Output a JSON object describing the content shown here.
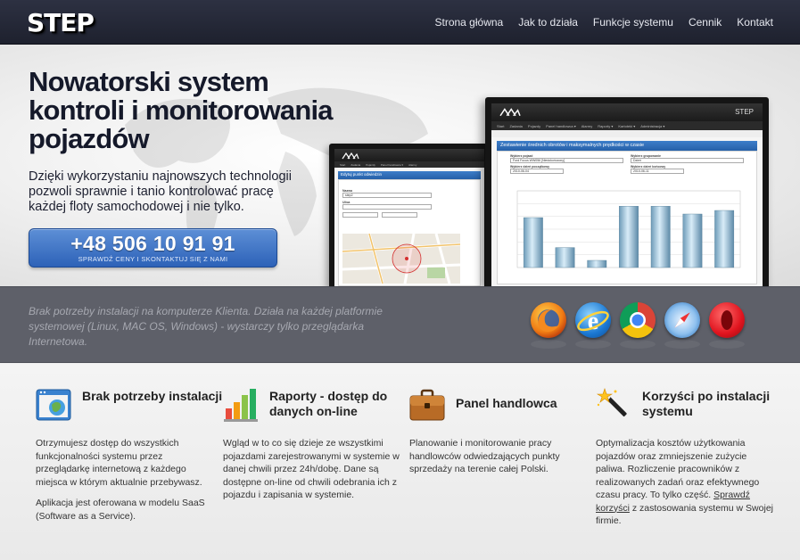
{
  "header": {
    "logo": "STEP",
    "nav": [
      "Strona główna",
      "Jak to działa",
      "Funkcje systemu",
      "Cennik",
      "Kontakt"
    ]
  },
  "hero": {
    "title_lines": [
      "Nowatorski system",
      "kontroli i monitorowania",
      "pojazdów"
    ],
    "subtitle": "Dzięki wykorzystaniu najnowszych technologii pozwoli sprawnie i tanio kontrolować pracę każdej floty samochodowej i nie tylko.",
    "phone": "+48 506 10 91 91",
    "phone_caption": "SPRAWDŹ CENY I SKONTAKTUJ SIĘ Z NAMI"
  },
  "screens": {
    "large": {
      "brand": "STEP",
      "menu": [
        "Start",
        "Zadania",
        "Pojazdy",
        "Panel handlowca ▾",
        "Alarmy",
        "Raporty ▾",
        "Kartoteki ▾",
        "Administracja ▾"
      ],
      "panel_title": "Zestawienie średnich obrotów i maksymalnych prędkości w czasie",
      "fields": [
        {
          "label": "Wybierz pojazd",
          "value": "Ford Focus WW056 [Niedokończony]"
        },
        {
          "label": "Wybierz grupowanie",
          "value": "Dzień"
        },
        {
          "label": "Wybierz dzień początkowy",
          "value": "2010-06-04"
        },
        {
          "label": "Wybierz dzień końcowy",
          "value": "2010-06-11"
        }
      ],
      "chart_bars": [
        0.7,
        0.28,
        0.1,
        0.86,
        0.86,
        0.75,
        0.8
      ]
    },
    "small": {
      "panel_title": "Edytuj punkt odwiedzin",
      "fields": [
        {
          "label": "Nazwa",
          "value": "step2"
        },
        {
          "label": "Ulica",
          "value": ""
        }
      ]
    }
  },
  "band": {
    "text": "Brak potrzeby instalacji na komputerze Klienta. Działa na każdej platformie systemowej (Linux, MAC OS, Windows) - wystarczy tylko przeglądarka Internetowa.",
    "browsers": [
      "firefox-icon",
      "internet-explorer-icon",
      "chrome-icon",
      "safari-icon",
      "opera-icon"
    ]
  },
  "features": [
    {
      "title": "Brak potrzeby instalacji",
      "paragraphs": [
        "Otrzymujesz dostęp do wszystkich funkcjonalności systemu przez przeglądarkę internetową z każdego miejsca w którym aktualnie przebywasz.",
        "Aplikacja jest oferowana w modelu SaaS (Software as a Service)."
      ]
    },
    {
      "title": "Raporty - dostęp do danych on-line",
      "paragraphs": [
        "Wgląd w to co się dzieje ze wszystkimi pojazdami zarejestrowanymi w systemie w danej chwili przez 24h/dobę. Dane są dostępne on-line od chwili odebrania ich z pojazdu i zapisania w systemie."
      ]
    },
    {
      "title": "Panel handlowca",
      "paragraphs": [
        "Planowanie i monitorowanie pracy handlowców odwiedzających punkty sprzedaży na terenie całej Polski."
      ]
    },
    {
      "title": "Korzyści po instalacji systemu",
      "text_before": "Optymalizacja kosztów użytkowania pojazdów oraz zmniejszenie zużycie paliwa. Rozliczenie pracowników z realizowanych zadań oraz efektywnego czasu pracy. To tylko część. ",
      "link": "Sprawdź korzyści",
      "text_after": " z zastosowania systemu w Swojej firmie."
    }
  ],
  "colors": {
    "topbar": "#262a38",
    "band": "#5e6069",
    "phone_button": "#3a70c4",
    "panel_blue": "#2f6db8"
  }
}
